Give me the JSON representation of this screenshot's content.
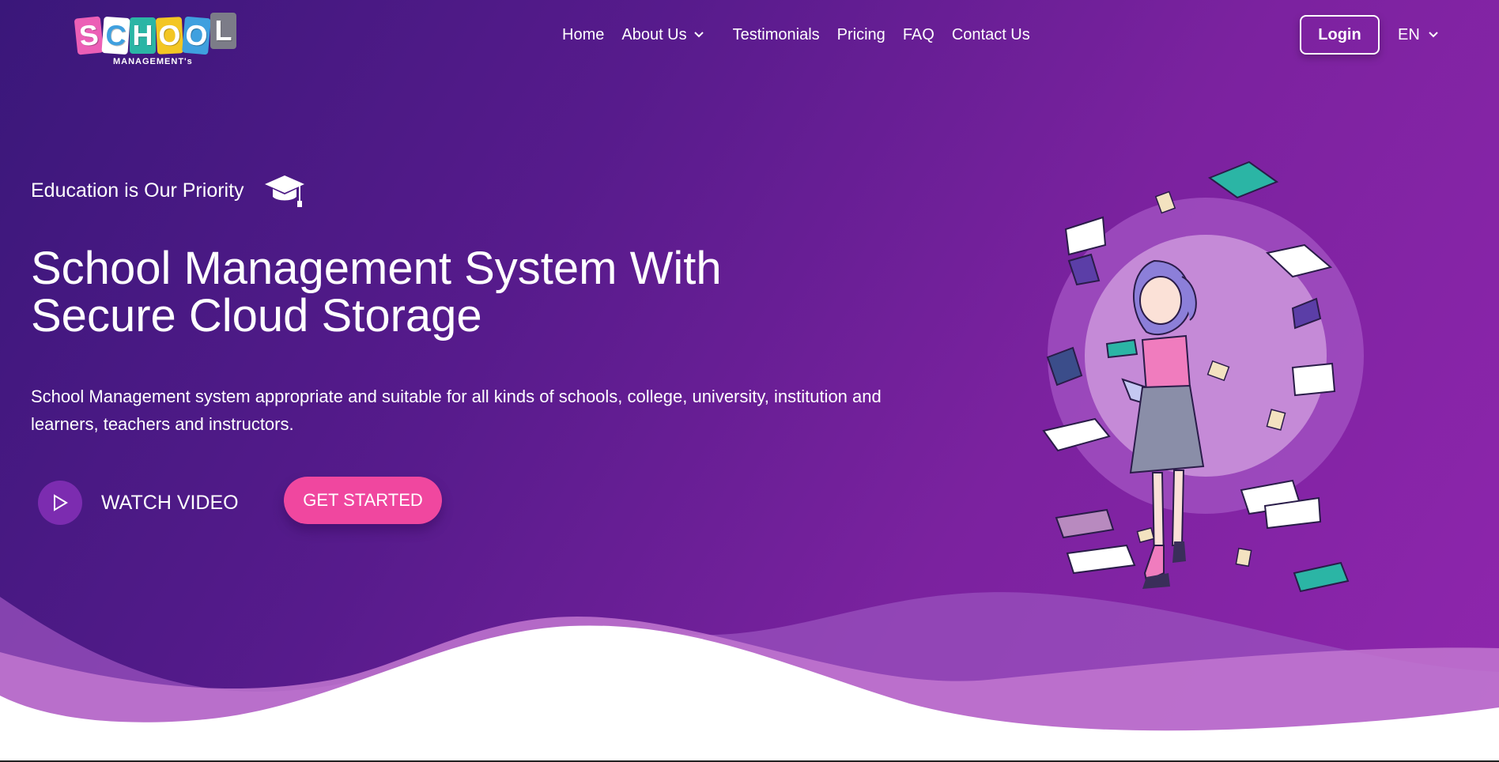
{
  "logo": {
    "letters": [
      "S",
      "C",
      "H",
      "O",
      "O",
      "L"
    ],
    "letter_colors": [
      "#ec5fb6",
      "#ffffff",
      "#2bb5a5",
      "#f3c623",
      "#3fa0df",
      "#7c7c88"
    ],
    "subtitle": "MANAGEMENT's"
  },
  "nav": {
    "items": [
      {
        "label": "Home"
      },
      {
        "label": "About Us",
        "has_dropdown": true
      },
      {
        "label": "Testimonials"
      },
      {
        "label": "Pricing"
      },
      {
        "label": "FAQ"
      },
      {
        "label": "Contact Us"
      }
    ],
    "login_label": "Login",
    "language": "EN"
  },
  "hero": {
    "eyebrow": "Education is Our Priority",
    "eyebrow_icon": "graduation-cap-icon",
    "title_line1": "School Management System With",
    "title_line2": "Secure Cloud Storage",
    "description": "School Management system appropriate and suitable for all kinds of schools, college, university, institution and learners, teachers and instructors.",
    "watch_video_label": "WATCH VIDEO",
    "get_started_label": "GET STARTED"
  },
  "colors": {
    "gradient_start": "#3a177a",
    "gradient_end": "#8f26ad",
    "accent_pink": "#f0479f",
    "play_circle": "#7c2cb0"
  }
}
